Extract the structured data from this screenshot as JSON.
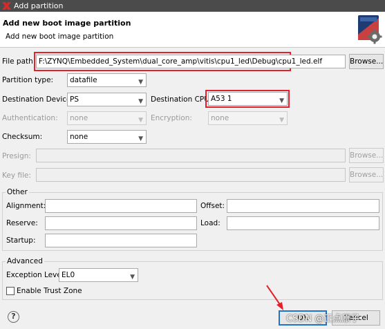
{
  "window": {
    "title": "Add partition"
  },
  "header": {
    "title": "Add new boot image partition",
    "subtitle": "Add new boot image partition"
  },
  "file_path": {
    "label": "File path:",
    "value": "F:\\ZYNQ\\Embedded_System\\dual_core_amp\\vitis\\cpu1_led\\Debug\\cpu1_led.elf",
    "browse": "Browse..."
  },
  "partition_type": {
    "label": "Partition type:",
    "value": "datafile"
  },
  "dest_device": {
    "label": "Destination Device:",
    "value": "PS"
  },
  "dest_cpu": {
    "label": "Destination CPU:",
    "value": "A53 1"
  },
  "authentication": {
    "label": "Authentication:",
    "value": "none"
  },
  "encryption": {
    "label": "Encryption:",
    "value": "none"
  },
  "checksum": {
    "label": "Checksum:",
    "value": "none"
  },
  "presign": {
    "label": "Presign:",
    "browse": "Browse..."
  },
  "key_file": {
    "label": "Key file:",
    "browse": "Browse..."
  },
  "other": {
    "title": "Other",
    "alignment": "Alignment:",
    "offset": "Offset:",
    "reserve": "Reserve:",
    "load": "Load:",
    "startup": "Startup:"
  },
  "advanced": {
    "title": "Advanced",
    "exception_label": "Exception Level",
    "exception_value": "EL0",
    "trust_zone": "Enable Trust Zone"
  },
  "footer": {
    "help": "?",
    "ok": "OK",
    "cancel": "Cancel"
  },
  "watermark": "CSDN @正点原子",
  "colors": {
    "highlight": "#e3202b",
    "titlebar": "#4b4b4b"
  }
}
